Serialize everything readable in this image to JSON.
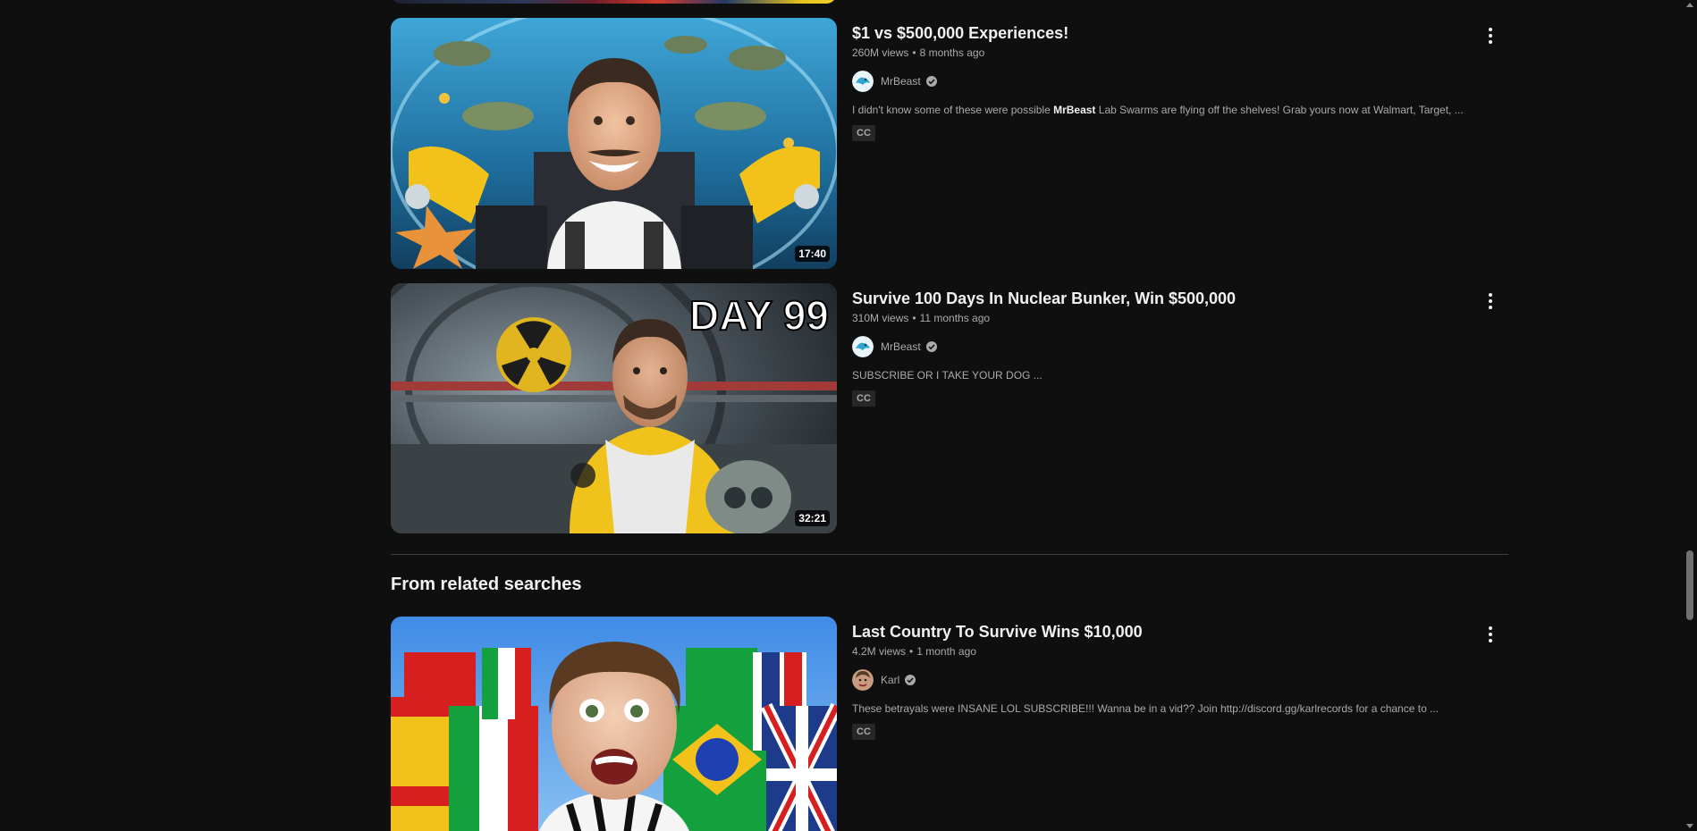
{
  "videos": [
    {
      "title": "$1 vs $500,000 Experiences!",
      "views": "260M views",
      "age": "8 months ago",
      "channel": "MrBeast",
      "description_pre": "I didn't know some of these were possible ",
      "description_bold": "MrBeast",
      "description_post": " Lab Swarms are flying off the shelves! Grab yours now at Walmart, Target, ...",
      "badge": "CC",
      "duration": "17:40",
      "thumb_icon": "underwater-thumbnail"
    },
    {
      "title": "Survive 100 Days In Nuclear Bunker, Win $500,000",
      "views": "310M views",
      "age": "11 months ago",
      "channel": "MrBeast",
      "description_pre": "SUBSCRIBE OR I TAKE YOUR DOG ...",
      "description_bold": "",
      "description_post": "",
      "badge": "CC",
      "duration": "32:21",
      "thumb_text": "DAY 99",
      "thumb_icon": "bunker-thumbnail"
    },
    {
      "title": "Last Country To Survive Wins $10,000",
      "views": "4.2M views",
      "age": "1 month ago",
      "channel": "Karl",
      "description_pre": "These betrayals were INSANE LOL SUBSCRIBE!!! Wanna be in a vid?? Join http://discord.gg/karlrecords for a chance to ...",
      "description_bold": "",
      "description_post": "",
      "badge": "CC",
      "thumb_icon": "flags-thumbnail"
    }
  ],
  "section": {
    "title": "From related searches"
  },
  "separator": "•",
  "colors": {
    "background": "#0f0f0f",
    "text_primary": "#f1f1f1",
    "text_secondary": "#aaaaaa",
    "badge_bg": "#272727"
  }
}
